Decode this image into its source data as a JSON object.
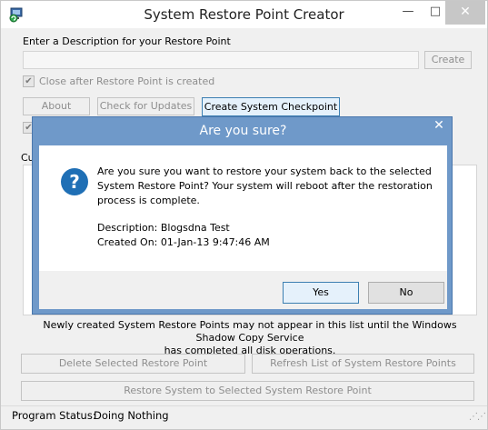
{
  "window": {
    "title": "System Restore Point Creator",
    "min_glyph": "—",
    "max_glyph": "□",
    "close_glyph": "✕"
  },
  "form": {
    "description_label": "Enter a Description for your Restore Point",
    "description_value": "",
    "create_label": "Create",
    "close_after_label": "Close after Restore Point is created",
    "close_after_checked": true,
    "checkbox2_checked": true,
    "check_glyph": "✔",
    "about_label": "About",
    "check_updates_label": "Check for Updates",
    "create_checkpoint_label": "Create System Checkpoint",
    "list_label_partial": "Cu"
  },
  "list_note": {
    "line1": "Newly created System Restore Points may not appear in this list until the Windows Shadow Copy Service",
    "line2": "has completed all disk operations."
  },
  "actions": {
    "delete_label": "Delete Selected Restore Point",
    "refresh_label": "Refresh List of System Restore Points",
    "restore_label": "Restore System to Selected System Restore Point"
  },
  "status": {
    "label": "Program Status:",
    "value": "Doing Nothing"
  },
  "dialog": {
    "title": "Are you sure?",
    "close_glyph": "✕",
    "icon": "question-icon",
    "message_line1": "Are you sure you want to restore your system back to the selected",
    "message_line2": "System Restore Point?  Your system will reboot after the restoration",
    "message_line3": "process is complete.",
    "description_line": "Description: Blogsdna Test",
    "created_line": "Created On: 01-Jan-13 9:47:46 AM",
    "yes_label": "Yes",
    "no_label": "No"
  },
  "colors": {
    "dialog_frame": "#6f99c9",
    "default_button": "#e5f1fb",
    "question_icon": "#1f6fb5"
  }
}
